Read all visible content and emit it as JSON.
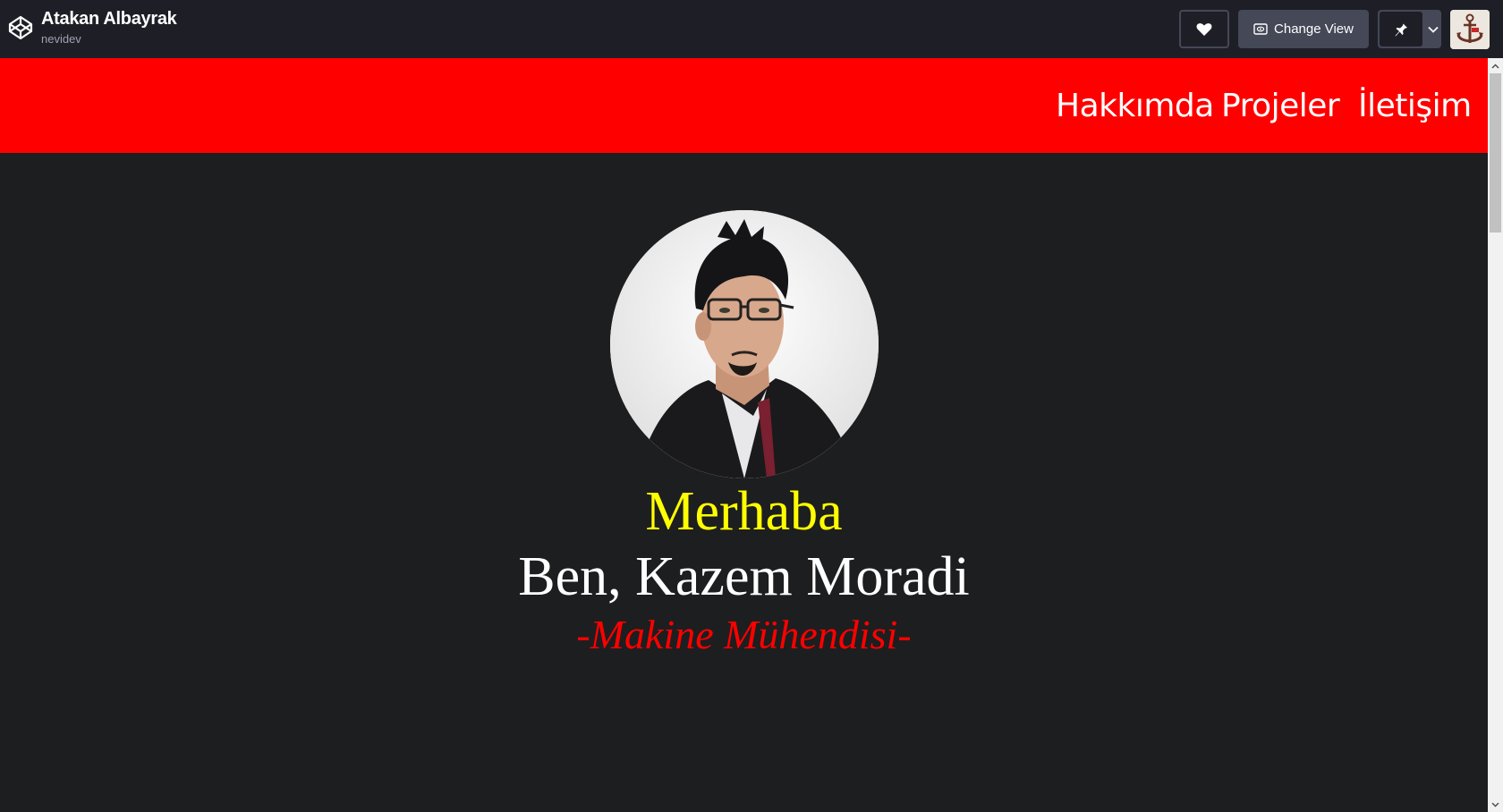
{
  "topbar": {
    "author_name": "Atakan Albayrak",
    "author_handle": "nevidev",
    "change_view_label": "Change View",
    "icons": [
      "codepen-logo-icon",
      "heart-icon",
      "eye-icon",
      "pin-icon",
      "chevron-down-icon"
    ]
  },
  "nav": {
    "items": [
      "Hakkımda",
      "Projeler",
      "İletişim"
    ]
  },
  "hero": {
    "greeting": "Merhaba",
    "name": "Ben, Kazem Moradi",
    "title": "-Makine Mühendisi-"
  },
  "colors": {
    "navbar": "#ff0000",
    "background": "#1d1e1f",
    "greeting": "#ffff00",
    "title": "#ff0000"
  }
}
